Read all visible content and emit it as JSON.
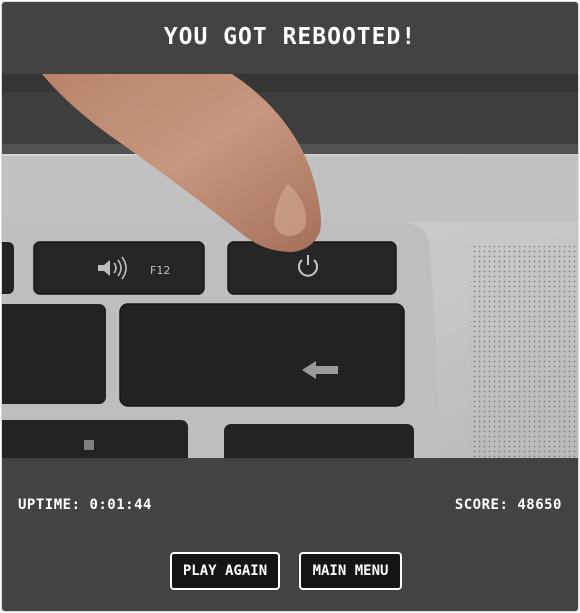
{
  "game_over": {
    "title": "YOU GOT REBOOTED!"
  },
  "image": {
    "subject": "finger pressing power key on laptop keyboard",
    "key_label": "F12"
  },
  "stats": {
    "uptime_label": "UPTIME:",
    "uptime_value": "0:01:44",
    "score_label": "SCORE:",
    "score_value": "48650"
  },
  "buttons": {
    "play_again": "PLAY AGAIN",
    "main_menu": "MAIN MENU"
  },
  "colors": {
    "panel_bg": "#434343",
    "button_bg": "#141414",
    "text": "#ffffff"
  }
}
